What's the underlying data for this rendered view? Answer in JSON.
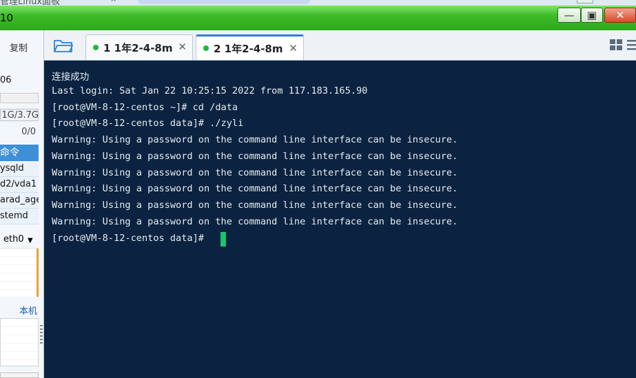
{
  "app": {
    "title_partial": "10",
    "top_faded_text": "管理Linux面板"
  },
  "window_controls": {
    "minimize": "—",
    "maximize": "▣",
    "close": "✕"
  },
  "sidebar": {
    "copy_label": "复制",
    "host_suffix": "06",
    "memory": "1G/3.7G",
    "swap": "0/0",
    "process_header": "命令",
    "processes": [
      "ysqld",
      "d2/vda1",
      "arad_age",
      "stemd"
    ],
    "interface": "eth0",
    "local_label": "本机"
  },
  "tabs": [
    {
      "number": "1",
      "label": "1 1年2-4-8m",
      "active": false
    },
    {
      "number": "2",
      "label": "2 1年2-4-8m",
      "active": true
    }
  ],
  "terminal": {
    "lines": [
      "连接成功",
      "Last login: Sat Jan 22 10:25:15 2022 from 117.183.165.90",
      "[root@VM-8-12-centos ~]# cd /data",
      "[root@VM-8-12-centos data]# ./zyli",
      "Warning: Using a password on the command line interface can be insecure.",
      "Warning: Using a password on the command line interface can be insecure.",
      "Warning: Using a password on the command line interface can be insecure.",
      "Warning: Using a password on the command line interface can be insecure.",
      "Warning: Using a password on the command line interface can be insecure.",
      "Warning: Using a password on the command line interface can be insecure.",
      "[root@VM-8-12-centos data]#"
    ],
    "background": "#0b2340",
    "cursor_color": "#18c56e"
  },
  "icons": {
    "folder": "folder-icon",
    "grid": "grid-view-icon",
    "list": "list-view-icon",
    "tab_close": "close-icon",
    "dropdown": "chevron-down-icon"
  },
  "colors": {
    "titlebar": "#3dbb29",
    "tab_active_accent": "#2b7fd9",
    "status_dot": "#21b838",
    "process_header": "#3f8fd6"
  }
}
